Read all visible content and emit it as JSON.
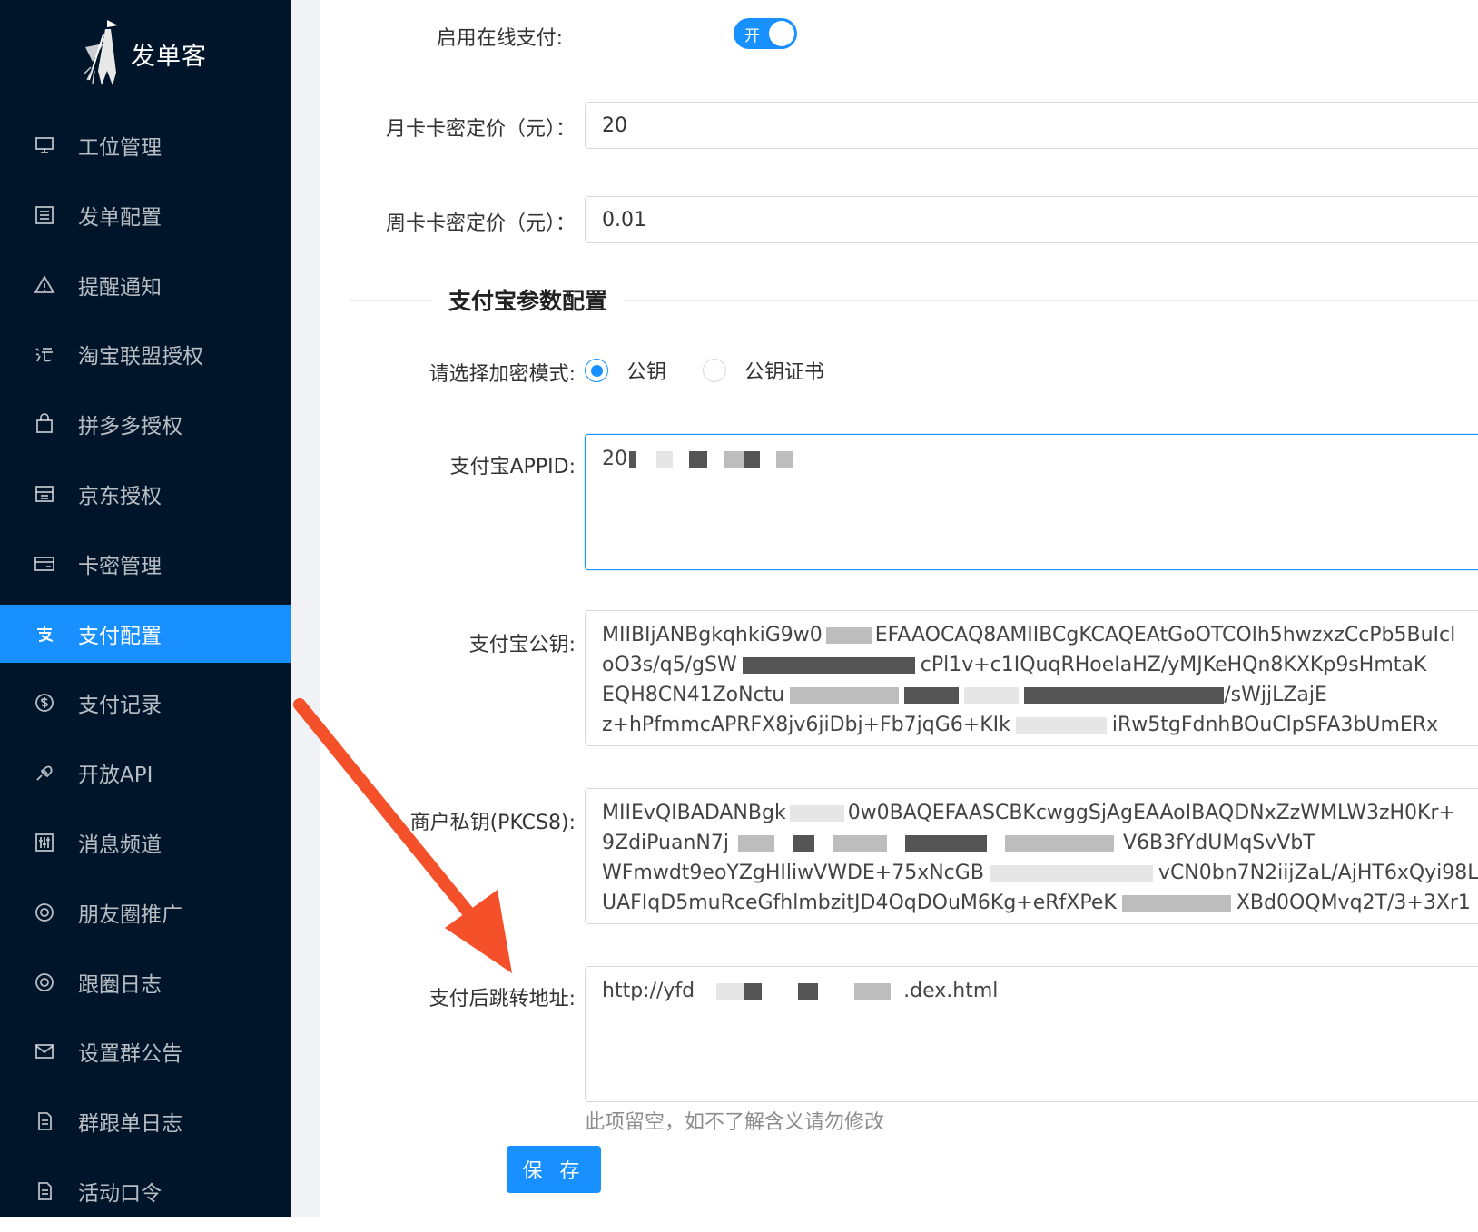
{
  "app": {
    "brand": "发单客"
  },
  "sidebar": {
    "items": [
      {
        "label": "工位管理",
        "icon": "monitor-icon"
      },
      {
        "label": "发单配置",
        "icon": "list-icon"
      },
      {
        "label": "提醒通知",
        "icon": "warning-icon"
      },
      {
        "label": "淘宝联盟授权",
        "icon": "taobao-icon"
      },
      {
        "label": "拼多多授权",
        "icon": "shopping-bag-icon"
      },
      {
        "label": "京东授权",
        "icon": "store-icon"
      },
      {
        "label": "卡密管理",
        "icon": "card-icon"
      },
      {
        "label": "支付配置",
        "icon": "alipay-icon",
        "active": true
      },
      {
        "label": "支付记录",
        "icon": "dollar-circle-icon"
      },
      {
        "label": "开放API",
        "icon": "api-icon"
      },
      {
        "label": "消息频道",
        "icon": "sliders-icon"
      },
      {
        "label": "朋友圈推广",
        "icon": "aperture-icon"
      },
      {
        "label": "跟圈日志",
        "icon": "aperture-icon"
      },
      {
        "label": "设置群公告",
        "icon": "mail-icon"
      },
      {
        "label": "群跟单日志",
        "icon": "file-icon"
      },
      {
        "label": "活动口令",
        "icon": "file-icon"
      }
    ]
  },
  "form": {
    "online_pay": {
      "label": "启用在线支付:",
      "switch_text": "开",
      "enabled": true
    },
    "monthly_price": {
      "label": "月卡卡密定价（元）：",
      "value": "20"
    },
    "weekly_price": {
      "label": "周卡卡密定价（元）：",
      "value": "0.01"
    },
    "section_title": "支付宝参数配置",
    "encrypt_mode": {
      "label": "请选择加密模式:",
      "options": [
        "公钥",
        "公钥证书"
      ],
      "selected": "公钥"
    },
    "appid": {
      "label": "支付宝APPID:",
      "value_visible": "20"
    },
    "alipay_public_key": {
      "label": "支付宝公钥:",
      "lines": [
        "MIIBIjANBgkqhkiG9w0",
        "oO3s/q5/gSW",
        "EQH8CN41ZoNctu",
        "z+hPfmmcAPRFX8jv6jiDbj+Fb7jqG6+KIk"
      ],
      "lines_tail": [
        "EFAAOCAQ8AMIIBCgKCAQEAtGoOTCOlh5hwzxzCcPb5BuIcl",
        "cPl1v+c1IQuqRHoeIaHZ/yMJKeHQn8KXKp9sHmtaK",
        "/sWjjLZajE",
        "iRw5tgFdnhBOuClpSFA3bUmERx"
      ]
    },
    "merchant_private_key": {
      "label": "商户私钥(PKCS8):",
      "lines": [
        "MIIEvQIBADANBgk",
        "9ZdiPuanN7j",
        "WFmwdt9eoYZgHIliwVWDE+75xNcGB",
        "UAFIqD5muRceGfhlmbzitJD4OqDOuM6Kg+eRfXPeK"
      ],
      "lines_tail": [
        "0w0BAQEFAASCBKcwggSjAgEAAoIBAQDNxZzWMLW3zH0Kr+",
        "V6B3fYdUMqSvVbT",
        "vCN0bn7N2iijZaL/AjHT6xQyi98L",
        "XBd0OQMvq2T/3+3Xr1"
      ]
    },
    "redirect_url": {
      "label": "支付后跳转地址:",
      "value_start": "http://yfd",
      "value_end": ".dex.html",
      "hint": "此项留空，如不了解含义请勿修改"
    },
    "save_label": "保 存"
  },
  "colors": {
    "sidebar_bg": "#001529",
    "accent": "#1890ff",
    "arrow": "#f4502a"
  }
}
